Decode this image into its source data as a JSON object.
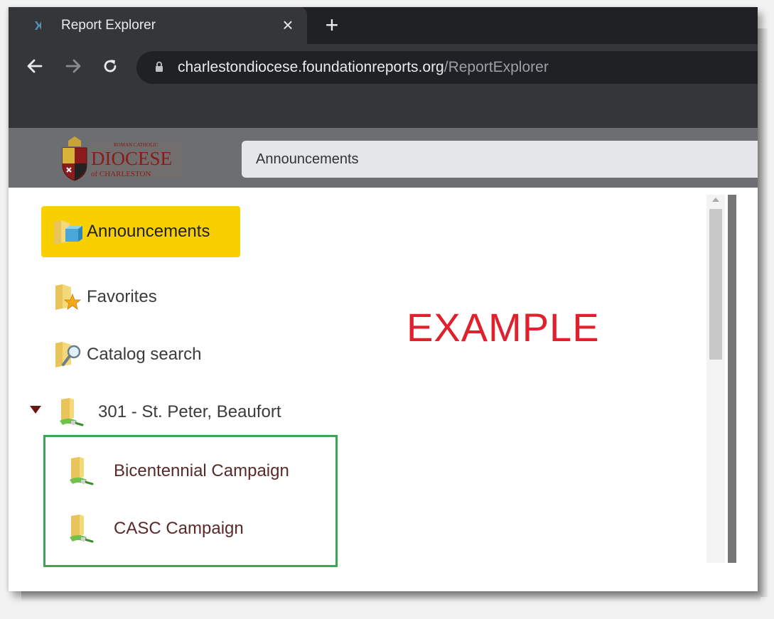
{
  "browser": {
    "tab_title": "Report Explorer",
    "tab_close_glyph": "×",
    "new_tab_glyph": "+",
    "url_host": "charlestondiocese.foundationreports.org",
    "url_path": "/ReportExplorer",
    "icons": [
      "report-explorer-favicon",
      "back-arrow-icon",
      "forward-arrow-icon",
      "reload-icon",
      "lock-icon"
    ]
  },
  "header": {
    "logo_line1": "ROMAN CATHOLIC",
    "logo_line2": "DIOCESE",
    "logo_line3": "of CHARLESTON",
    "search_value": "Announcements"
  },
  "tree": {
    "items": [
      {
        "label": "Announcements",
        "icon": "announcements-folder-icon",
        "selected": true
      },
      {
        "label": "Favorites",
        "icon": "favorites-folder-icon",
        "selected": false
      },
      {
        "label": "Catalog search",
        "icon": "catalog-search-icon",
        "selected": false
      }
    ],
    "parent": {
      "label": "301 - St. Peter, Beaufort",
      "icon": "network-folder-icon",
      "expanded": true
    },
    "children": [
      {
        "label": "Bicentennial Campaign",
        "icon": "network-folder-icon"
      },
      {
        "label": "CASC Campaign",
        "icon": "network-folder-icon"
      }
    ]
  },
  "watermark": "EXAMPLE",
  "colors": {
    "selected_bg": "#f8d000",
    "highlight_border": "#3aa655",
    "watermark": "#e0202c",
    "appbar": "#6d6e71",
    "chrome_dark": "#202124",
    "chrome_tab": "#35363a"
  }
}
